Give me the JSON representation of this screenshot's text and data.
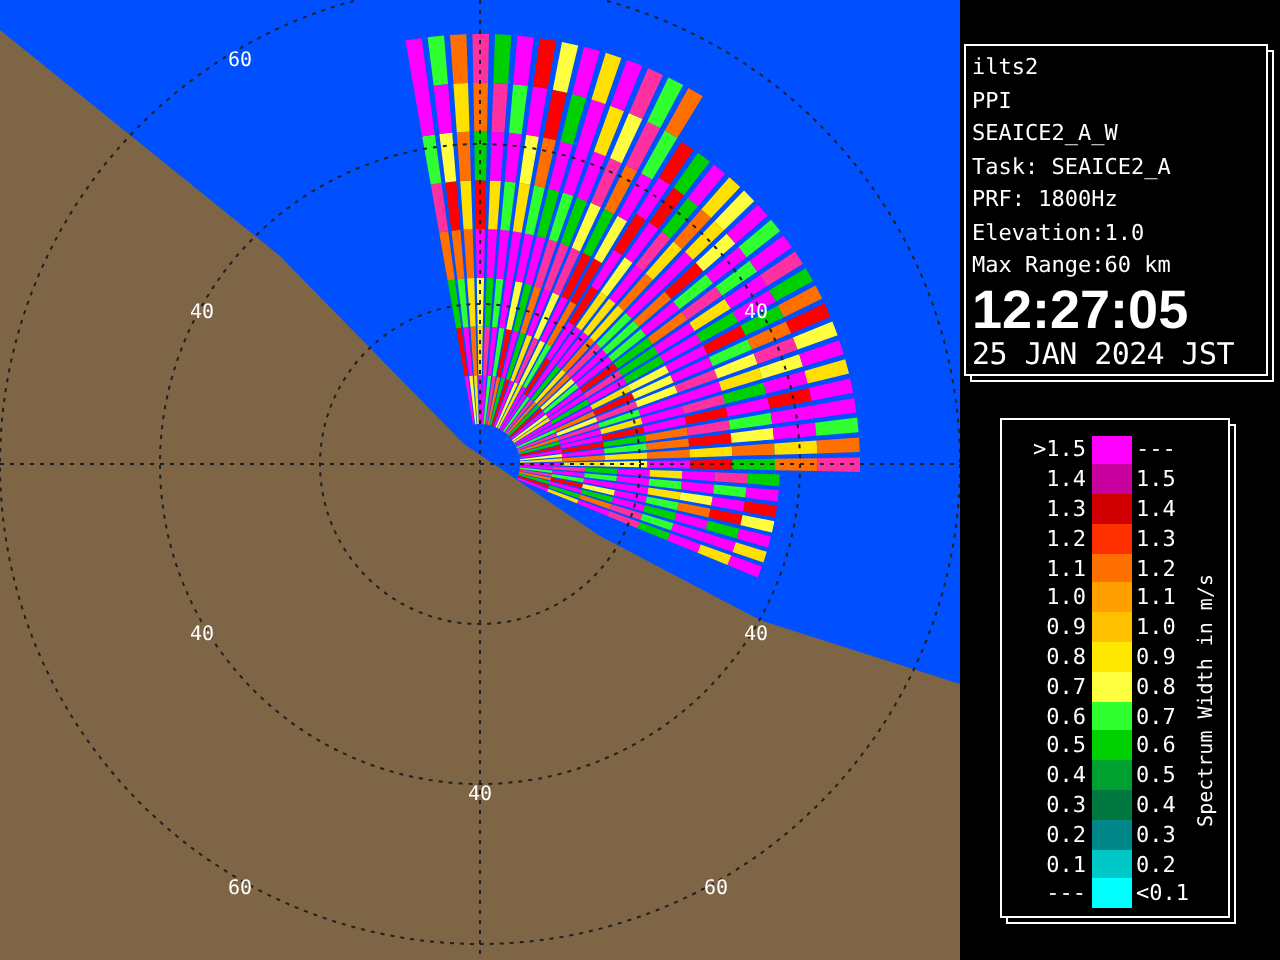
{
  "map": {
    "range_labels": [
      "60",
      "40",
      "40",
      "40",
      "40",
      "40",
      "60",
      "60"
    ]
  },
  "info": {
    "lines": [
      "ilts2",
      "PPI",
      "SEAICE2_A_W",
      "Task: SEAICE2_A",
      "PRF: 1800Hz",
      "Elevation:1.0",
      "Max Range:60 km"
    ],
    "time": "12:27:05",
    "date": "25 JAN 2024 JST"
  },
  "legend": {
    "title": "Spectrum Width in m/s",
    "rows": [
      {
        "low": ">1.5",
        "high": "---",
        "color": "#ff00ff"
      },
      {
        "low": "1.4",
        "high": "1.5",
        "color": "#c800a0"
      },
      {
        "low": "1.3",
        "high": "1.4",
        "color": "#d00000"
      },
      {
        "low": "1.2",
        "high": "1.3",
        "color": "#ff3000"
      },
      {
        "low": "1.1",
        "high": "1.2",
        "color": "#ff7000"
      },
      {
        "low": "1.0",
        "high": "1.1",
        "color": "#ffa000"
      },
      {
        "low": "0.9",
        "high": "1.0",
        "color": "#ffc000"
      },
      {
        "low": "0.8",
        "high": "0.9",
        "color": "#ffe800"
      },
      {
        "low": "0.7",
        "high": "0.8",
        "color": "#ffff40"
      },
      {
        "low": "0.6",
        "high": "0.7",
        "color": "#30ff30"
      },
      {
        "low": "0.5",
        "high": "0.6",
        "color": "#00d000"
      },
      {
        "low": "0.4",
        "high": "0.5",
        "color": "#00a030"
      },
      {
        "low": "0.3",
        "high": "0.4",
        "color": "#007840"
      },
      {
        "low": "0.2",
        "high": "0.3",
        "color": "#008888"
      },
      {
        "low": "0.1",
        "high": "0.2",
        "color": "#00c8c8"
      },
      {
        "low": "---",
        "high": "<0.1",
        "color": "#00ffff"
      }
    ]
  }
}
